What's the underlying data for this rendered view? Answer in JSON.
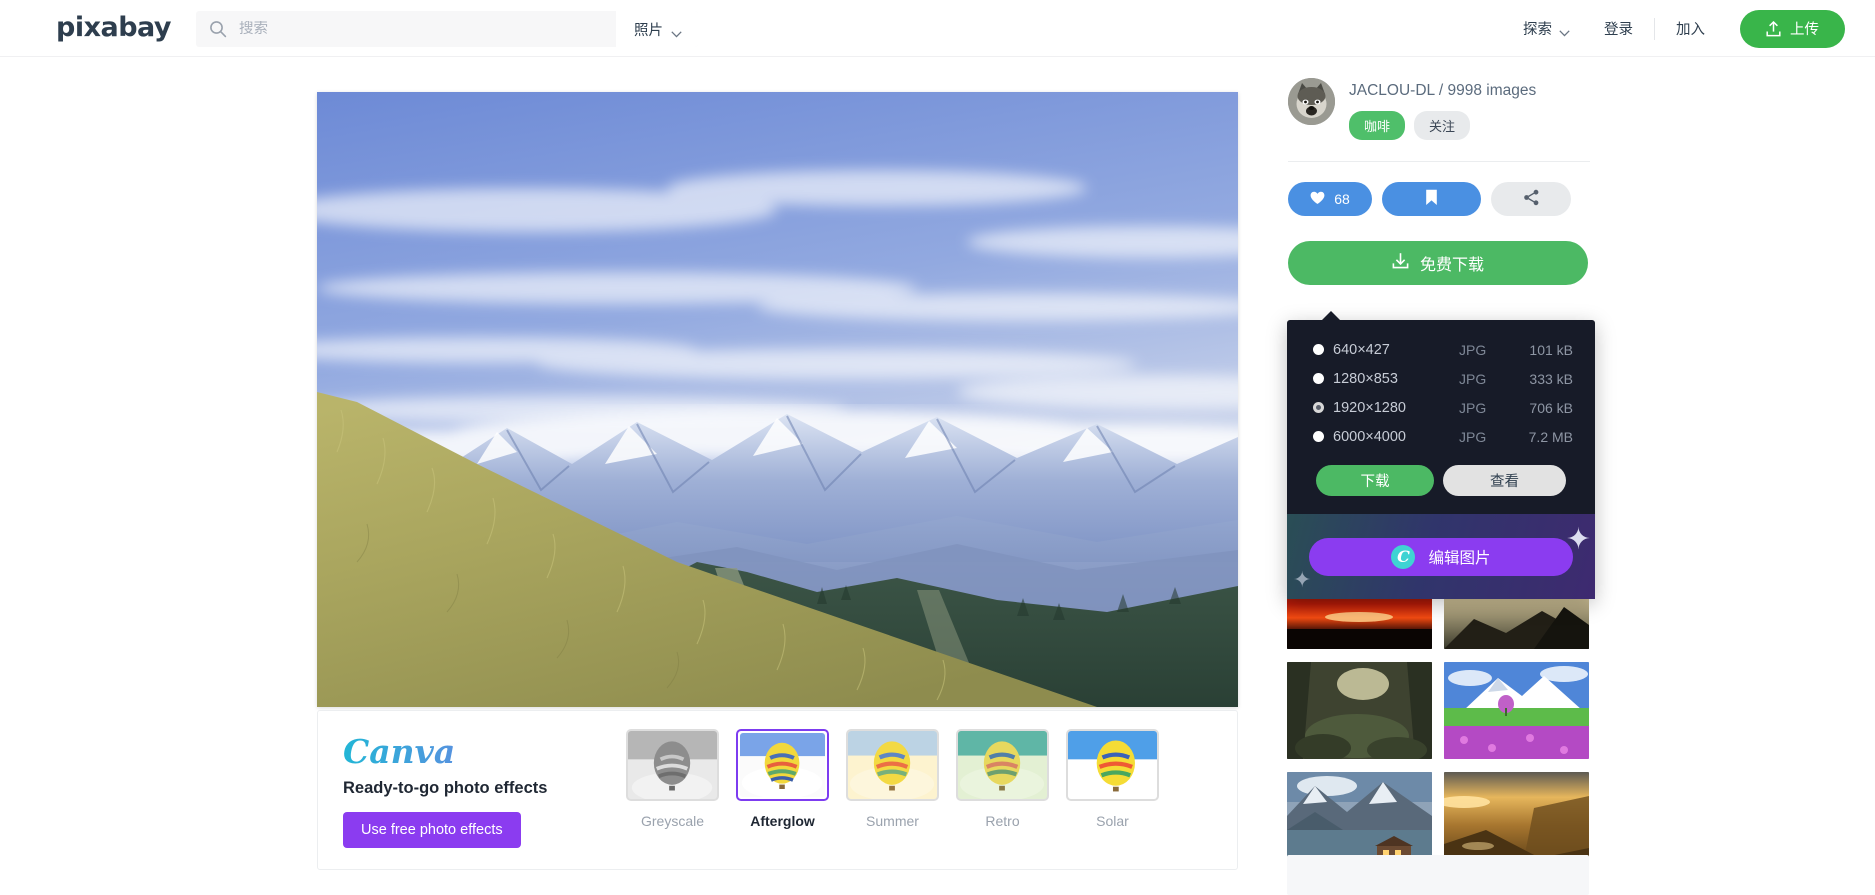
{
  "header": {
    "logo": "pixabay",
    "search": {
      "placeholder": "搜索",
      "value": "",
      "icon": "search-icon"
    },
    "media_type": {
      "label": "照片",
      "icon": "chevron-down-icon"
    },
    "nav": [
      {
        "name": "explore",
        "label": "探索",
        "has_chevron": true
      },
      {
        "name": "login",
        "label": "登录",
        "has_chevron": false
      },
      {
        "name": "join",
        "label": "加入",
        "has_chevron": false
      }
    ],
    "upload_button": {
      "label": "上传",
      "icon": "upload-icon",
      "color": "#39b54a"
    }
  },
  "sidebar": {
    "user": {
      "name_line": "JACLOU-DL / 9998 images",
      "avatar_icon": "avatar",
      "badges": [
        {
          "name": "coffee",
          "label": "咖啡",
          "color": "#4fbf6a"
        },
        {
          "name": "follow",
          "label": "关注",
          "color": "#e8eaec"
        }
      ]
    },
    "actions": {
      "like": {
        "label": "68",
        "icon": "heart-icon",
        "color": "#4a90e2"
      },
      "save": {
        "label": "",
        "icon": "bookmark-icon",
        "color": "#4a90e2"
      },
      "share": {
        "label": "",
        "icon": "share-icon",
        "color": "#e8eaec"
      }
    },
    "download_button": {
      "label": "免费下载",
      "icon": "download-icon",
      "color": "#4cb964"
    }
  },
  "download_panel": {
    "columns": [
      "size",
      "format",
      "filesize"
    ],
    "options": [
      {
        "size": "640×427",
        "format": "JPG",
        "filesize": "101 kB",
        "selected": false
      },
      {
        "size": "1280×853",
        "format": "JPG",
        "filesize": "333 kB",
        "selected": false
      },
      {
        "size": "1920×1280",
        "format": "JPG",
        "filesize": "706 kB",
        "selected": true
      },
      {
        "size": "6000×4000",
        "format": "JPG",
        "filesize": "7.2 MB",
        "selected": false
      }
    ],
    "download_label": "下载",
    "view_label": "查看",
    "canva_banner": {
      "label": "编辑图片",
      "icon": "canva-c-icon",
      "color": "#8b3cf0"
    }
  },
  "canva_promo": {
    "logo": "Canva",
    "headline": "Ready-to-go photo effects",
    "button_label": "Use free photo effects",
    "filters": [
      {
        "name": "greyscale",
        "label": "Greyscale",
        "active": false
      },
      {
        "name": "afterglow",
        "label": "Afterglow",
        "active": true
      },
      {
        "name": "summer",
        "label": "Summer",
        "active": false
      },
      {
        "name": "retro",
        "label": "Retro",
        "active": false
      },
      {
        "name": "solar",
        "label": "Solar",
        "active": false
      }
    ]
  },
  "related_images": [
    {
      "name": "red-sunset"
    },
    {
      "name": "mountain-ridge-sunrise"
    },
    {
      "name": "sunbeam-forest"
    },
    {
      "name": "snow-mountain-flowers"
    },
    {
      "name": "lake-cabin-mountains"
    },
    {
      "name": "golden-canyon"
    }
  ]
}
